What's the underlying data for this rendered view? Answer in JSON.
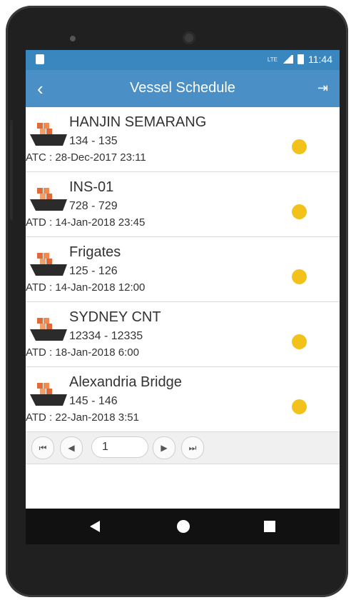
{
  "status": {
    "time": "11:44",
    "network": "LTE"
  },
  "appbar": {
    "title": "Vessel Schedule"
  },
  "vessels": [
    {
      "name": "HANJIN SEMARANG",
      "voyage": "134 - 135",
      "eta": "ATC : 28-Dec-2017 23:11"
    },
    {
      "name": "INS-01",
      "voyage": "728 - 729",
      "eta": "ATD : 14-Jan-2018 23:45"
    },
    {
      "name": "Frigates",
      "voyage": "125 - 126",
      "eta": "ATD : 14-Jan-2018 12:00"
    },
    {
      "name": "SYDNEY CNT",
      "voyage": "12334 - 12335",
      "eta": "ATD : 18-Jan-2018 6:00"
    },
    {
      "name": "Alexandria Bridge",
      "voyage": "145 - 146",
      "eta": "ATD : 22-Jan-2018 3:51"
    }
  ],
  "pager": {
    "first": "⏮",
    "prev": "◀",
    "page": "1",
    "next": "▶",
    "last": "⏭"
  },
  "colors": {
    "appbar": "#4a8fc6",
    "status_dot": "#f2c21a"
  }
}
